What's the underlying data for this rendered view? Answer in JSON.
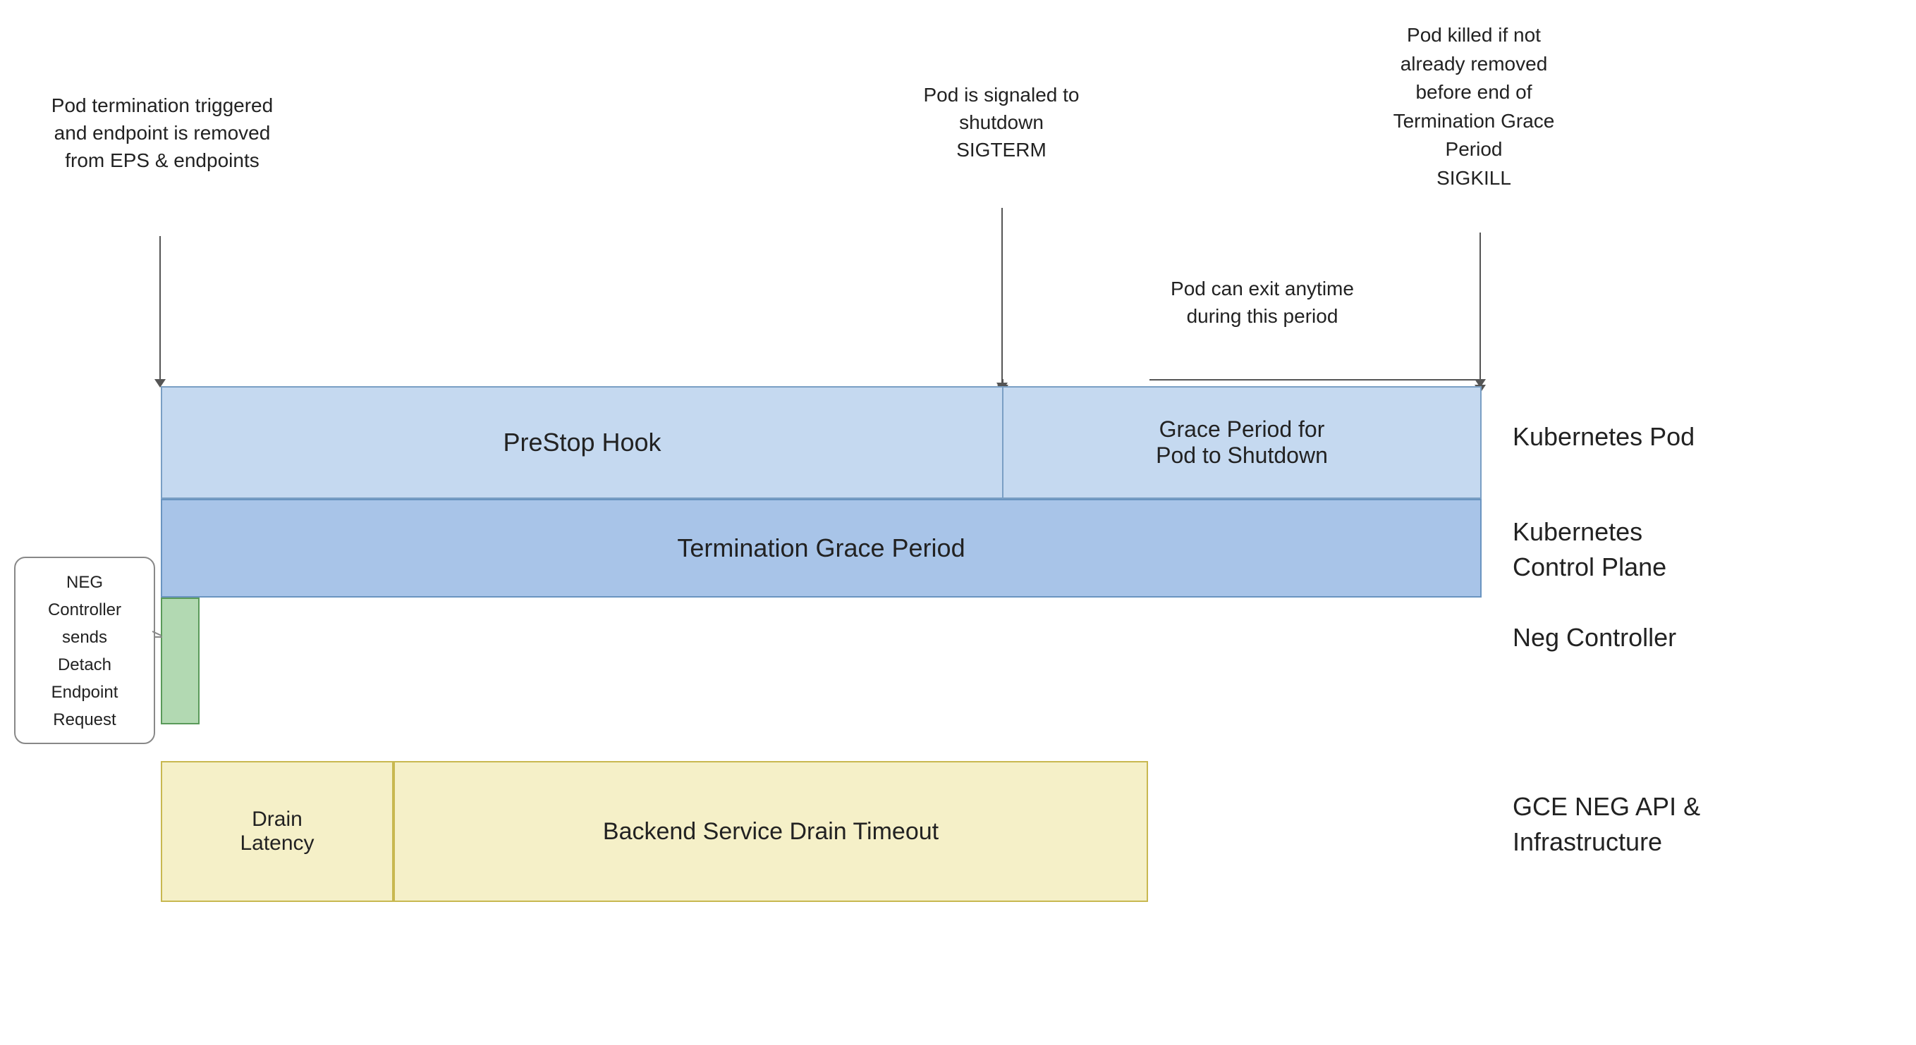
{
  "annotations": {
    "trigger_label": "Pod termination triggered\nand endpoint is removed\nfrom EPS & endpoints",
    "sigterm_label": "Pod is signaled to\nshutdown\nSIGTERM",
    "sigkill_label": "Pod killed if not\nalready removed\nbefore end of\nTermination Grace\nPeriod\nSIGKILL",
    "pod_exit_label": "Pod can exit anytime\nduring this period",
    "grace_shutdown_label": "Grace Period for\nPod to Shutdown",
    "prestop_label": "PreStop Hook",
    "termination_grace_label": "Termination Grace Period",
    "drain_latency_label": "Drain\nLatency",
    "backend_drain_label": "Backend Service Drain Timeout",
    "neg_controller_label": "NEG\nController\nsends\nDetach\nEndpoint\nRequest",
    "row_k8s_pod": "Kubernetes Pod",
    "row_k8s_control": "Kubernetes\nControl Plane",
    "row_neg_controller": "Neg Controller",
    "row_gce_neg": "GCE NEG API &\nInfrastructure"
  }
}
